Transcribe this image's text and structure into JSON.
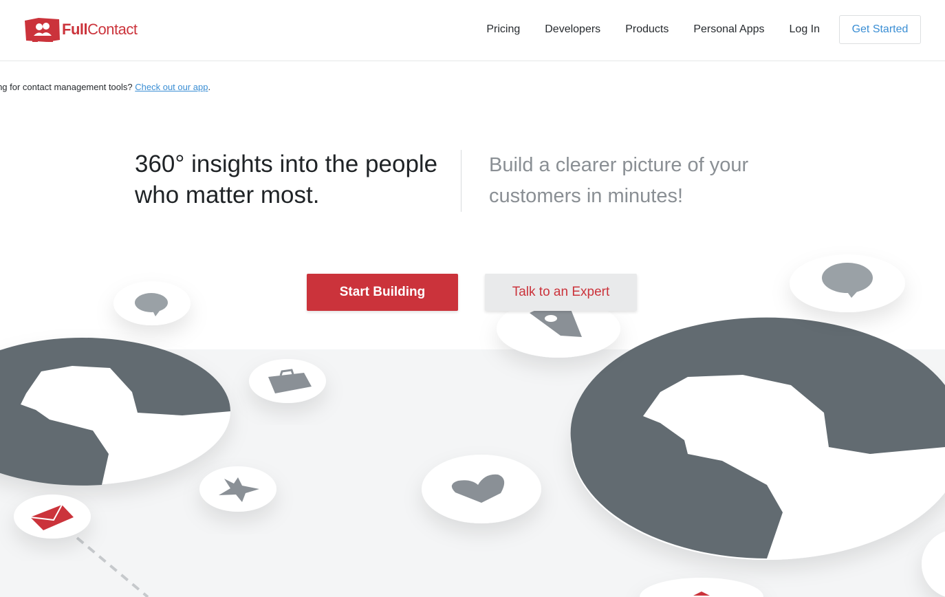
{
  "brand": {
    "name_bold": "Full",
    "name_regular": "Contact",
    "color": "#cb333b"
  },
  "nav": {
    "items": [
      {
        "label": "Pricing"
      },
      {
        "label": "Developers"
      },
      {
        "label": "Products"
      },
      {
        "label": "Personal Apps"
      },
      {
        "label": "Log In"
      }
    ],
    "cta_label": "Get Started",
    "cta_color": "#3a8ed4"
  },
  "app_note": {
    "text": "Looking for contact management tools?",
    "link_label": "Check out our app",
    "suffix": "."
  },
  "hero": {
    "headline": "360° insights into the people who matter most.",
    "subheadline": "Build a clearer picture of your customers in minutes!"
  },
  "actions": {
    "primary_label": "Start Building",
    "secondary_label": "Talk to an Expert"
  },
  "illustration": {
    "icons": [
      "chat-bubble-icon",
      "map-pin-icon",
      "briefcase-icon",
      "star-icon",
      "heart-icon",
      "envelope-icon",
      "person-silhouette-icon"
    ],
    "colors": {
      "silhouette": "#626b71",
      "bubble": "#ffffff",
      "icon_gray": "#9aa1a6",
      "icon_red": "#cb333b"
    }
  }
}
